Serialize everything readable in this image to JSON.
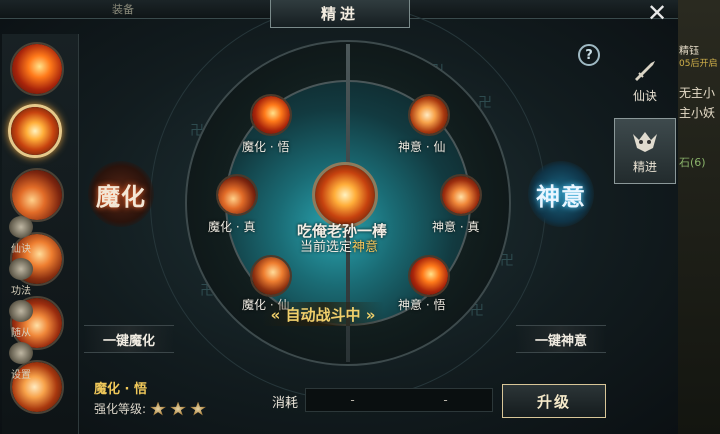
{
  "header": {
    "title": "精进",
    "close_label": "✕",
    "top_left_text": "装备"
  },
  "left_skills": [
    {
      "name": "skill-slot-1",
      "selected": false
    },
    {
      "name": "skill-slot-2",
      "selected": true
    },
    {
      "name": "skill-slot-3",
      "selected": false
    },
    {
      "name": "skill-slot-4",
      "selected": false
    },
    {
      "name": "skill-slot-5",
      "selected": false
    },
    {
      "name": "skill-slot-6",
      "selected": false
    }
  ],
  "wheel": {
    "center_skill_name": "吃俺老孙一棒",
    "current_selected_prefix": "当前选定",
    "current_selected_value": "神意",
    "nodes": [
      {
        "label": "魔化 · 悟"
      },
      {
        "label": "魔化 · 真"
      },
      {
        "label": "魔化 · 仙"
      },
      {
        "label": "神意 · 仙"
      },
      {
        "label": "神意 · 真"
      },
      {
        "label": "神意 · 悟"
      }
    ],
    "auto_fight": "« 自动战斗中 »"
  },
  "sides": {
    "left_big": "魔化",
    "right_big": "神意",
    "left_button": "一键魔化",
    "right_button": "一键神意"
  },
  "help": "?",
  "tabs": [
    {
      "label": "仙诀",
      "active": false
    },
    {
      "label": "精进",
      "active": true
    }
  ],
  "bottom": {
    "selected_node": "魔化 · 悟",
    "level_label": "强化等级:",
    "cost_label": "消耗",
    "cost_values": [
      "-",
      "-"
    ],
    "upgrade_label": "升级"
  },
  "right_hud": {
    "texts": [
      "精钰",
      "05后开启",
      "无主小",
      "主小妖",
      "石(6)"
    ],
    "items": [
      "仙诀",
      "功法",
      "随从",
      "设置"
    ]
  },
  "colors": {
    "accent_gold": "#f0c85a",
    "panel_bg": "#121c1f",
    "mohua_glow": "#ff6a2a",
    "shenyi_glow": "#5ad0ff"
  }
}
